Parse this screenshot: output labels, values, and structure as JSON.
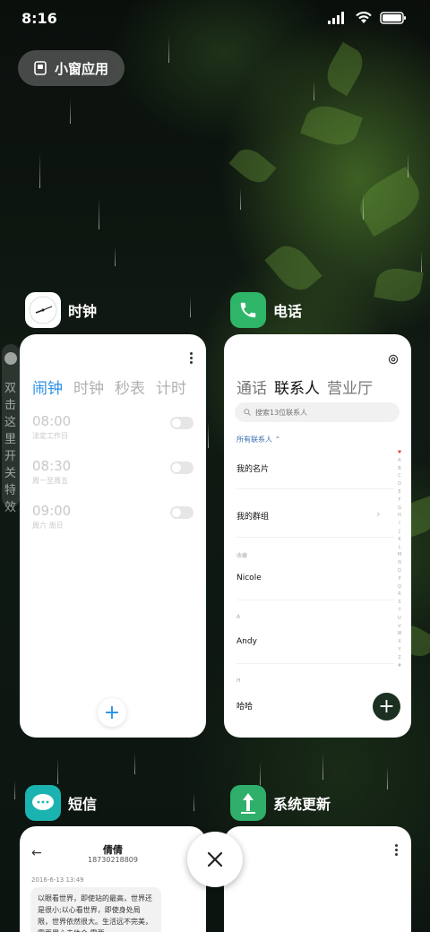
{
  "status": {
    "time": "8:16"
  },
  "float_window": {
    "label": "小窗应用",
    "icon": "small-window-icon"
  },
  "side_tip": {
    "text": "双击这里开关特效"
  },
  "apps": {
    "clock": {
      "name": "时钟",
      "icon": "clock-icon",
      "tabs": [
        "闹钟",
        "时钟",
        "秒表",
        "计时"
      ],
      "alarms": [
        {
          "time": "08:00",
          "desc": "法定工作日"
        },
        {
          "time": "08:30",
          "desc": "周一至周五"
        },
        {
          "time": "09:00",
          "desc": "周六 周日"
        }
      ],
      "add": "+"
    },
    "phone": {
      "name": "电话",
      "icon": "phone-icon",
      "tabs": [
        "通话",
        "联系人",
        "营业厅"
      ],
      "search_placeholder": "搜索13位联系人",
      "filter": "所有联系人 ⌃",
      "my_card": "我的名片",
      "my_group": "我的群组",
      "section_fav": "收藏",
      "contact1": "Nicole",
      "section_a": "A",
      "contact2": "Andy",
      "section_h": "H",
      "contact3": "哈哈",
      "index": [
        "♥",
        "A",
        "B",
        "C",
        "D",
        "E",
        "F",
        "G",
        "H",
        "I",
        "J",
        "K",
        "L",
        "M",
        "N",
        "O",
        "P",
        "Q",
        "R",
        "S",
        "T",
        "U",
        "V",
        "W",
        "X",
        "Y",
        "Z",
        "#"
      ],
      "add": "+"
    },
    "sms": {
      "name": "短信",
      "icon": "message-icon",
      "contact_name": "倩倩",
      "contact_number": "18730218809",
      "date": "2016-6-13 13:49",
      "message": "以眼看世界，即使站的最高，世界还是很小;以心看世界，即使身处局限，世界依然很大。生活远不完美，需要用心去体会,需要...",
      "back": "←"
    },
    "update": {
      "name": "系统更新",
      "icon": "update-icon"
    }
  },
  "close_icon": "close-icon"
}
